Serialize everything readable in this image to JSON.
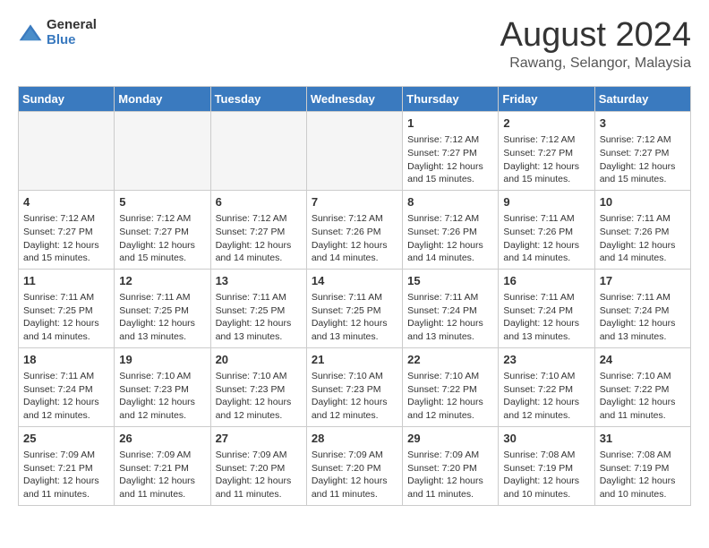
{
  "header": {
    "logo_general": "General",
    "logo_blue": "Blue",
    "month_year": "August 2024",
    "location": "Rawang, Selangor, Malaysia"
  },
  "days_of_week": [
    "Sunday",
    "Monday",
    "Tuesday",
    "Wednesday",
    "Thursday",
    "Friday",
    "Saturday"
  ],
  "weeks": [
    [
      {
        "day": "",
        "empty": true
      },
      {
        "day": "",
        "empty": true
      },
      {
        "day": "",
        "empty": true
      },
      {
        "day": "",
        "empty": true
      },
      {
        "day": "1",
        "sunrise": "7:12 AM",
        "sunset": "7:27 PM",
        "daylight": "12 hours and 15 minutes."
      },
      {
        "day": "2",
        "sunrise": "7:12 AM",
        "sunset": "7:27 PM",
        "daylight": "12 hours and 15 minutes."
      },
      {
        "day": "3",
        "sunrise": "7:12 AM",
        "sunset": "7:27 PM",
        "daylight": "12 hours and 15 minutes."
      }
    ],
    [
      {
        "day": "4",
        "sunrise": "7:12 AM",
        "sunset": "7:27 PM",
        "daylight": "12 hours and 15 minutes."
      },
      {
        "day": "5",
        "sunrise": "7:12 AM",
        "sunset": "7:27 PM",
        "daylight": "12 hours and 15 minutes."
      },
      {
        "day": "6",
        "sunrise": "7:12 AM",
        "sunset": "7:27 PM",
        "daylight": "12 hours and 14 minutes."
      },
      {
        "day": "7",
        "sunrise": "7:12 AM",
        "sunset": "7:26 PM",
        "daylight": "12 hours and 14 minutes."
      },
      {
        "day": "8",
        "sunrise": "7:12 AM",
        "sunset": "7:26 PM",
        "daylight": "12 hours and 14 minutes."
      },
      {
        "day": "9",
        "sunrise": "7:11 AM",
        "sunset": "7:26 PM",
        "daylight": "12 hours and 14 minutes."
      },
      {
        "day": "10",
        "sunrise": "7:11 AM",
        "sunset": "7:26 PM",
        "daylight": "12 hours and 14 minutes."
      }
    ],
    [
      {
        "day": "11",
        "sunrise": "7:11 AM",
        "sunset": "7:25 PM",
        "daylight": "12 hours and 14 minutes."
      },
      {
        "day": "12",
        "sunrise": "7:11 AM",
        "sunset": "7:25 PM",
        "daylight": "12 hours and 13 minutes."
      },
      {
        "day": "13",
        "sunrise": "7:11 AM",
        "sunset": "7:25 PM",
        "daylight": "12 hours and 13 minutes."
      },
      {
        "day": "14",
        "sunrise": "7:11 AM",
        "sunset": "7:25 PM",
        "daylight": "12 hours and 13 minutes."
      },
      {
        "day": "15",
        "sunrise": "7:11 AM",
        "sunset": "7:24 PM",
        "daylight": "12 hours and 13 minutes."
      },
      {
        "day": "16",
        "sunrise": "7:11 AM",
        "sunset": "7:24 PM",
        "daylight": "12 hours and 13 minutes."
      },
      {
        "day": "17",
        "sunrise": "7:11 AM",
        "sunset": "7:24 PM",
        "daylight": "12 hours and 13 minutes."
      }
    ],
    [
      {
        "day": "18",
        "sunrise": "7:11 AM",
        "sunset": "7:24 PM",
        "daylight": "12 hours and 12 minutes."
      },
      {
        "day": "19",
        "sunrise": "7:10 AM",
        "sunset": "7:23 PM",
        "daylight": "12 hours and 12 minutes."
      },
      {
        "day": "20",
        "sunrise": "7:10 AM",
        "sunset": "7:23 PM",
        "daylight": "12 hours and 12 minutes."
      },
      {
        "day": "21",
        "sunrise": "7:10 AM",
        "sunset": "7:23 PM",
        "daylight": "12 hours and 12 minutes."
      },
      {
        "day": "22",
        "sunrise": "7:10 AM",
        "sunset": "7:22 PM",
        "daylight": "12 hours and 12 minutes."
      },
      {
        "day": "23",
        "sunrise": "7:10 AM",
        "sunset": "7:22 PM",
        "daylight": "12 hours and 12 minutes."
      },
      {
        "day": "24",
        "sunrise": "7:10 AM",
        "sunset": "7:22 PM",
        "daylight": "12 hours and 11 minutes."
      }
    ],
    [
      {
        "day": "25",
        "sunrise": "7:09 AM",
        "sunset": "7:21 PM",
        "daylight": "12 hours and 11 minutes."
      },
      {
        "day": "26",
        "sunrise": "7:09 AM",
        "sunset": "7:21 PM",
        "daylight": "12 hours and 11 minutes."
      },
      {
        "day": "27",
        "sunrise": "7:09 AM",
        "sunset": "7:20 PM",
        "daylight": "12 hours and 11 minutes."
      },
      {
        "day": "28",
        "sunrise": "7:09 AM",
        "sunset": "7:20 PM",
        "daylight": "12 hours and 11 minutes."
      },
      {
        "day": "29",
        "sunrise": "7:09 AM",
        "sunset": "7:20 PM",
        "daylight": "12 hours and 11 minutes."
      },
      {
        "day": "30",
        "sunrise": "7:08 AM",
        "sunset": "7:19 PM",
        "daylight": "12 hours and 10 minutes."
      },
      {
        "day": "31",
        "sunrise": "7:08 AM",
        "sunset": "7:19 PM",
        "daylight": "12 hours and 10 minutes."
      }
    ]
  ],
  "labels": {
    "sunrise_prefix": "Sunrise: ",
    "sunset_prefix": "Sunset: ",
    "daylight_prefix": "Daylight: "
  }
}
